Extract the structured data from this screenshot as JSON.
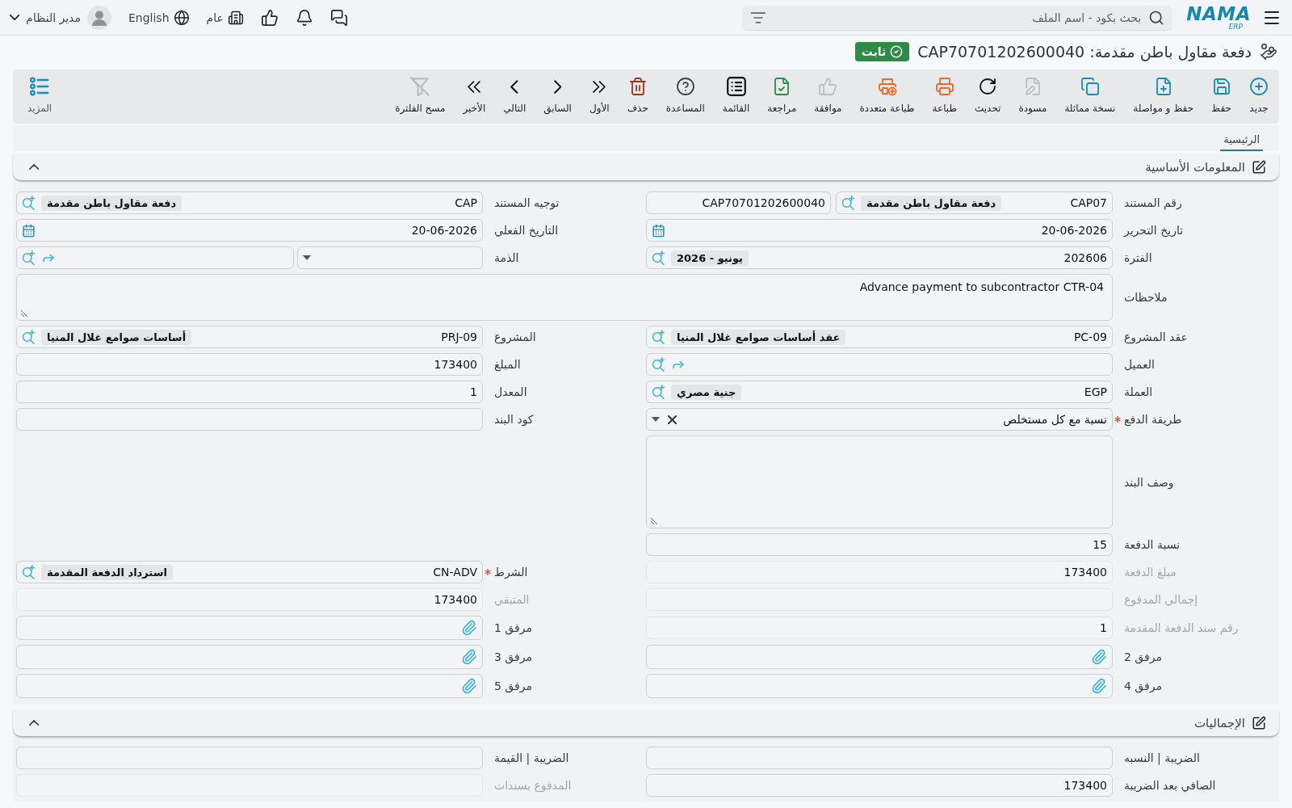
{
  "topbar": {
    "logo": {
      "name": "NAMA",
      "sub": "ERP"
    },
    "search": {
      "placeholder": "بحث بكود - اسم الملف"
    },
    "branch": "عام",
    "language": "English",
    "user": "مدير النظام"
  },
  "page": {
    "title": "دفعة مقاول باطن مقدمة: CAP70701202600040",
    "status": "ثابت"
  },
  "toolbar": {
    "items": [
      {
        "label": "جديد",
        "kind": "new",
        "disabled": false
      },
      {
        "label": "حفظ",
        "kind": "save",
        "disabled": false
      },
      {
        "label": "حفظ و مواصلة",
        "kind": "savenext",
        "disabled": false
      },
      {
        "label": "نسخة مماثلة",
        "kind": "duplicate",
        "disabled": false
      },
      {
        "label": "مسودة",
        "kind": "draft",
        "disabled": true
      },
      {
        "label": "تحديث",
        "kind": "refresh",
        "disabled": false
      },
      {
        "label": "طباعة",
        "kind": "print",
        "disabled": false
      },
      {
        "label": "طباعة متعددة",
        "kind": "multiprint",
        "disabled": false
      },
      {
        "label": "موافقة",
        "kind": "approve",
        "disabled": true
      },
      {
        "label": "مراجعة",
        "kind": "review",
        "disabled": false
      },
      {
        "label": "القائمة",
        "kind": "list",
        "disabled": false
      },
      {
        "label": "المساعدة",
        "kind": "help",
        "disabled": false
      },
      {
        "label": "حذف",
        "kind": "delete",
        "disabled": false
      },
      {
        "label": "الأول",
        "kind": "first",
        "disabled": false
      },
      {
        "label": "السابق",
        "kind": "previous",
        "disabled": false
      },
      {
        "label": "التالي",
        "kind": "next",
        "disabled": false
      },
      {
        "label": "الأخير",
        "kind": "last",
        "disabled": false
      },
      {
        "label": "مسح الفلترة",
        "kind": "clearfilter",
        "disabled": true
      }
    ],
    "more": "المزيد"
  },
  "tabs": [
    {
      "label": "الرئيسية",
      "selected": true
    }
  ],
  "sections": [
    {
      "title": "المعلومات الأساسية",
      "expanded": true,
      "rows": [
        {
          "fields": [
            {
              "label": "رقم المستند",
              "kind": "lookup",
              "value": "CAP07",
              "chip": "دفعة مقاول باطن مقدمة",
              "serial": "CAP70701202600040",
              "required": false,
              "readonly": false
            },
            {
              "label": "توجيه المستند",
              "kind": "lookup",
              "value": "CAP",
              "chip": "دفعة مقاول باطن مقدمة",
              "required": false,
              "readonly": false
            }
          ]
        },
        {
          "fields": [
            {
              "label": "تاريخ التحرير",
              "kind": "date",
              "value": "20-06-2026",
              "required": false,
              "readonly": false
            },
            {
              "label": "التاريخ الفعلي",
              "kind": "date",
              "value": "20-06-2026",
              "required": false,
              "readonly": false
            }
          ]
        },
        {
          "fields": [
            {
              "label": "الفترة",
              "kind": "lookup",
              "value": "202606",
              "chip": "يونيو - 2026",
              "required": false,
              "readonly": false
            },
            {
              "label": "الذمة",
              "kind": "account",
              "required": false,
              "readonly": false
            }
          ]
        },
        {
          "fields": [
            {
              "label": "ملاحظات",
              "kind": "notes",
              "value": "Advance payment to subcontractor CTR-04",
              "required": false,
              "readonly": false
            }
          ]
        },
        {
          "fields": [
            {
              "label": "عقد المشروع",
              "kind": "lookup",
              "value": "PC-09",
              "chip": "عقد أساسات صوامع غلال المنيا",
              "required": false,
              "readonly": false
            },
            {
              "label": "المشروع",
              "kind": "lookup",
              "value": "PRJ-09",
              "chip": "أساسات صوامع غلال المنيا",
              "required": false,
              "readonly": false
            }
          ]
        },
        {
          "fields": [
            {
              "label": "العميل",
              "kind": "lookup",
              "required": false,
              "readonly": false
            },
            {
              "label": "المبلغ",
              "kind": "text",
              "value": "173400",
              "required": false,
              "readonly": false
            }
          ]
        },
        {
          "fields": [
            {
              "label": "العملة",
              "kind": "lookup",
              "value": "EGP",
              "chip": "جنية مصري",
              "required": false,
              "readonly": false
            },
            {
              "label": "المعدل",
              "kind": "text",
              "value": "1",
              "required": false,
              "readonly": false
            }
          ]
        },
        {
          "fields": [
            {
              "label": "طريقة الدفع",
              "kind": "select",
              "value": "نسبة مع كل مستخلص",
              "required": true,
              "readonly": false
            },
            {
              "label": "كود البند",
              "kind": "text",
              "required": false,
              "readonly": false
            }
          ]
        },
        {
          "fields": [
            {
              "label": "وصف البند",
              "kind": "memo",
              "required": false,
              "readonly": false
            }
          ]
        },
        {
          "fields": [
            {
              "label": "نسبة الدفعة",
              "kind": "text",
              "value": "15",
              "required": false,
              "readonly": false
            }
          ]
        },
        {
          "fields": [
            {
              "label": "مبلغ الدفعة",
              "kind": "text",
              "value": "173400",
              "required": false,
              "readonly": true
            },
            {
              "label": "الشرط",
              "kind": "lookup",
              "value": "CN-ADV",
              "chip": "استرداد الدفعة المقدمة",
              "required": true,
              "readonly": false
            }
          ]
        },
        {
          "fields": [
            {
              "label": "إجمالي المدفوع",
              "kind": "text",
              "required": false,
              "readonly": true
            },
            {
              "label": "المتبقي",
              "kind": "text",
              "value": "173400",
              "required": false,
              "readonly": true
            }
          ]
        },
        {
          "fields": [
            {
              "label": "رقم سند الدفعة المقدمة",
              "kind": "text",
              "value": "1",
              "required": false,
              "readonly": true
            },
            {
              "label": "مرفق 1",
              "kind": "attachment",
              "required": false,
              "readonly": false
            }
          ]
        },
        {
          "fields": [
            {
              "label": "مرفق 2",
              "kind": "attachment",
              "required": false,
              "readonly": false
            },
            {
              "label": "مرفق 3",
              "kind": "attachment",
              "required": false,
              "readonly": false
            }
          ]
        },
        {
          "fields": [
            {
              "label": "مرفق 4",
              "kind": "attachment",
              "required": false,
              "readonly": false
            },
            {
              "label": "مرفق 5",
              "kind": "attachment",
              "required": false,
              "readonly": false
            }
          ]
        }
      ]
    },
    {
      "title": "الإجماليات",
      "expanded": true,
      "rows": [
        {
          "fields": [
            {
              "label": "الضريبة | النسبه",
              "kind": "text",
              "required": false,
              "readonly": false
            },
            {
              "label": "الضريبة | القيمة",
              "kind": "text",
              "required": false,
              "readonly": false
            }
          ]
        },
        {
          "fields": [
            {
              "label": "الصافي بعد الضريبة",
              "kind": "text",
              "value": "173400",
              "required": false,
              "readonly": false
            },
            {
              "label": "المدفوع بسندات",
              "kind": "text",
              "required": false,
              "readonly": true
            }
          ]
        }
      ]
    }
  ]
}
